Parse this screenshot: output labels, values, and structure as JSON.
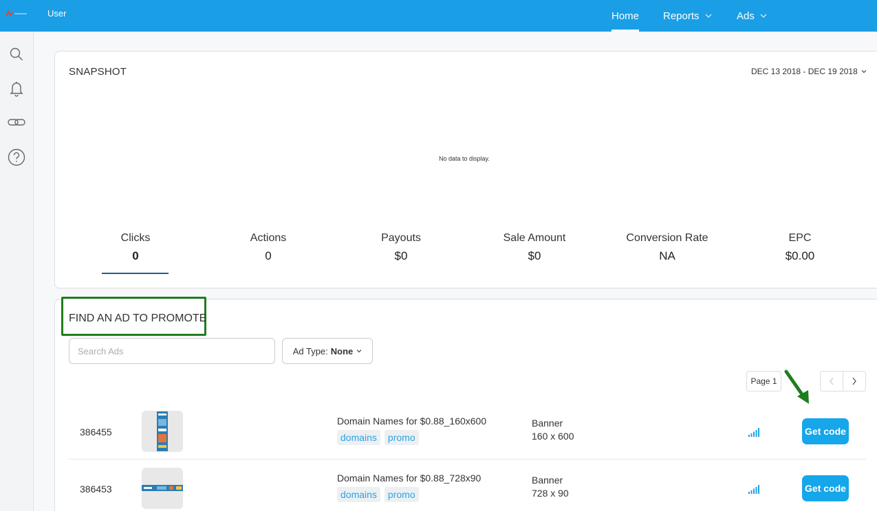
{
  "header": {
    "user_label": "User",
    "nav": [
      {
        "label": "Home",
        "active": true
      },
      {
        "label": "Reports",
        "has_dropdown": true
      },
      {
        "label": "Ads",
        "has_dropdown": true
      }
    ],
    "background_color": "#1a9ee5"
  },
  "left_rail": {
    "icons": [
      "search-icon",
      "bell-icon",
      "link-icon",
      "help-icon"
    ]
  },
  "snapshot": {
    "title": "SNAPSHOT",
    "date_range": "DEC 13 2018 - DEC 19 2018",
    "empty_message": "No data to display.",
    "metrics": [
      {
        "label": "Clicks",
        "value": "0",
        "active": true
      },
      {
        "label": "Actions",
        "value": "0"
      },
      {
        "label": "Payouts",
        "value": "$0"
      },
      {
        "label": "Sale Amount",
        "value": "$0"
      },
      {
        "label": "Conversion Rate",
        "value": "NA"
      },
      {
        "label": "EPC",
        "value": "$0.00"
      }
    ]
  },
  "find_ad": {
    "title": "FIND AN AD TO PROMOTE",
    "search_placeholder": "Search Ads",
    "ad_type_label": "Ad Type:",
    "ad_type_value": "None",
    "page_label": "Page 1",
    "highlight_color": "#1e7d1e",
    "ads": [
      {
        "id": "386455",
        "name": "Domain Names for $0.88_160x600",
        "tags": [
          "domains",
          "promo"
        ],
        "type": "Banner",
        "size": "160 x 600",
        "action": "Get code"
      },
      {
        "id": "386453",
        "name": "Domain Names for $0.88_728x90",
        "tags": [
          "domains",
          "promo"
        ],
        "type": "Banner",
        "size": "728 x 90",
        "action": "Get code"
      }
    ]
  },
  "colors": {
    "accent": "#16a6ea",
    "tag_text": "#29a3df",
    "annotation_green": "#1e7d1e"
  }
}
